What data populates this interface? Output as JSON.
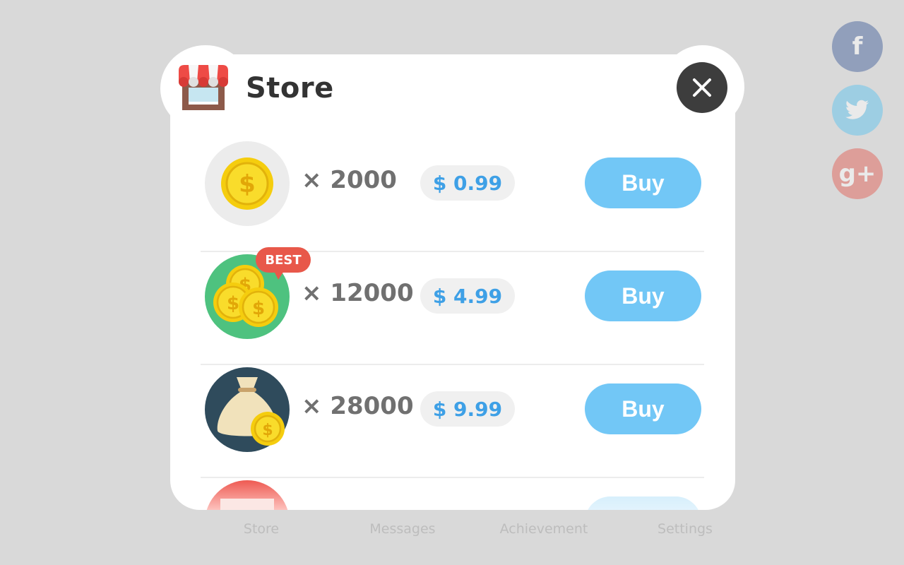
{
  "modal": {
    "title": "Store",
    "items": [
      {
        "quantity": "× 2000",
        "price": "$ 0.99",
        "buy_label": "Buy",
        "icon": "single-coin-icon",
        "badge": ""
      },
      {
        "quantity": "× 12000",
        "price": "$ 4.99",
        "buy_label": "Buy",
        "icon": "coin-stack-icon",
        "badge": "BEST"
      },
      {
        "quantity": "× 28000",
        "price": "$ 9.99",
        "buy_label": "Buy",
        "icon": "money-bag-icon",
        "badge": ""
      }
    ]
  },
  "social": [
    "facebook-icon",
    "twitter-icon",
    "google-plus-icon"
  ],
  "bottom_nav": {
    "items": [
      "Store",
      "Messages",
      "Achievement",
      "Settings"
    ]
  },
  "colors": {
    "buy_button": "#72c7f6",
    "price_text": "#3ea0e6",
    "best_badge": "#e8584a",
    "close_button": "#3d3d3d",
    "overlay": "#d9d9d9"
  }
}
